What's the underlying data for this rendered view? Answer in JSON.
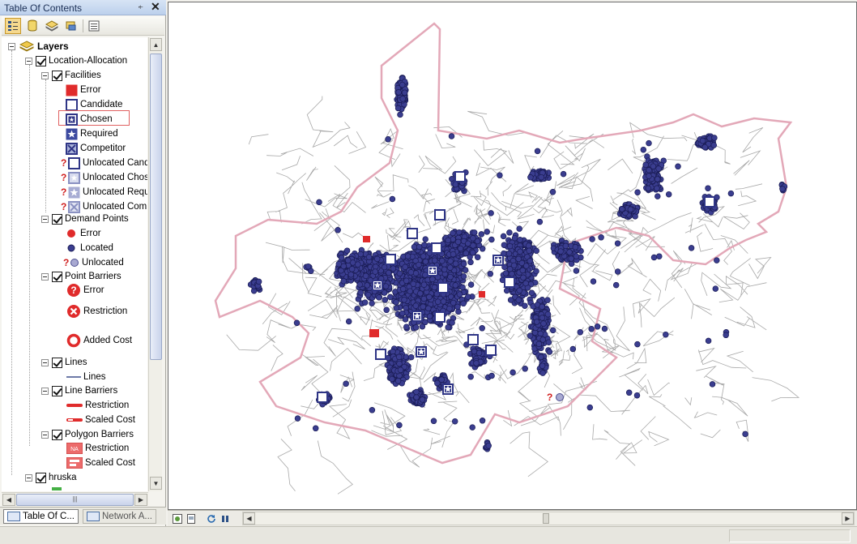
{
  "toc": {
    "title": "Table Of Contents",
    "pin_glyph": "⍅",
    "close_glyph": "✕",
    "toolbar": [
      {
        "name": "list-by-drawing-order-button",
        "active": true
      },
      {
        "name": "list-by-source-button",
        "active": false
      },
      {
        "name": "list-by-visibility-button",
        "active": false
      },
      {
        "name": "list-by-selection-button",
        "active": false
      },
      {
        "name": "options-button",
        "active": false
      }
    ],
    "tree": {
      "layers": "Layers",
      "location_allocation": "Location-Allocation",
      "facilities": "Facilities",
      "facility_items": [
        "Error",
        "Candidate",
        "Chosen",
        "Required",
        "Competitor",
        "Unlocated Cand",
        "Unlocated Chos",
        "Unlocated Requ",
        "Unlocated Comp"
      ],
      "demand_points": "Demand Points",
      "demand_items": [
        "Error",
        "Located",
        "Unlocated"
      ],
      "point_barriers": "Point Barriers",
      "point_items": [
        "Error",
        "Restriction",
        "Added Cost"
      ],
      "lines": "Lines",
      "line_items": [
        "Lines"
      ],
      "line_barriers": "Line Barriers",
      "line_barrier_items": [
        "Restriction",
        "Scaled Cost"
      ],
      "polygon_barriers": "Polygon Barriers",
      "polygon_items": [
        "Restriction",
        "Scaled Cost"
      ],
      "hruska": "hruska"
    },
    "tabs": [
      "Table Of C...",
      "Network A..."
    ]
  },
  "colors": {
    "demand": "#3a3d8f",
    "demand_outline": "#1a1c55",
    "facility": "#2f3586",
    "boundary": "#e3a8b8",
    "roads": "#a8a8a8",
    "error_red": "#e02b2b"
  }
}
